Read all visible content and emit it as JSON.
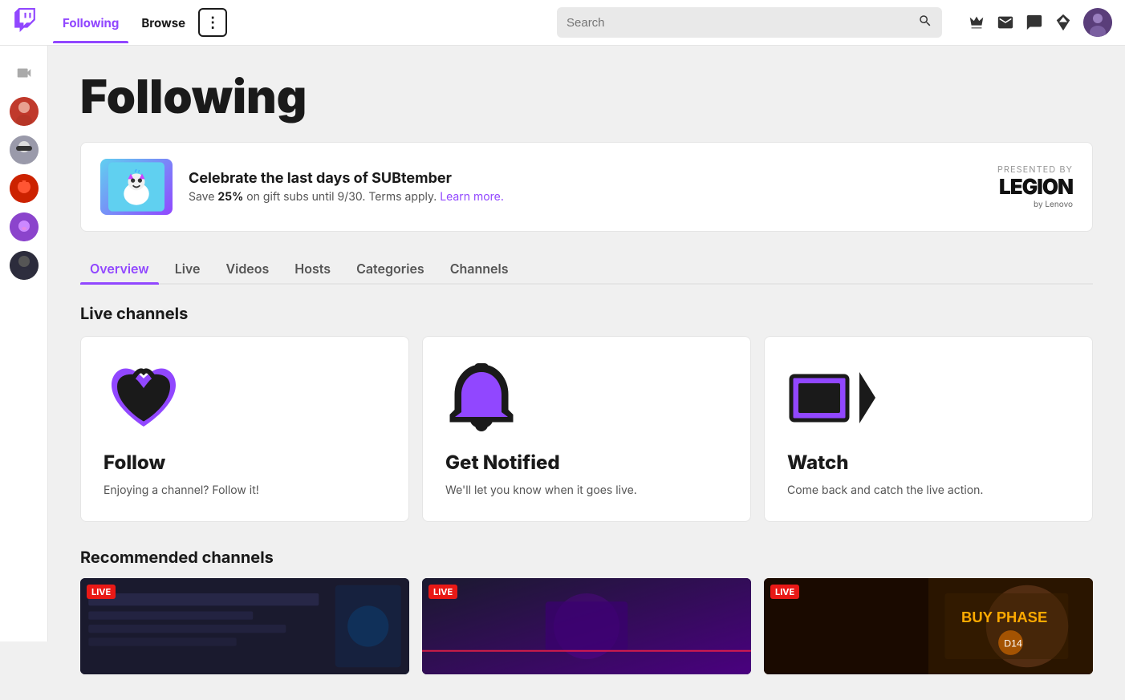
{
  "nav": {
    "logo": "twitch",
    "links": [
      {
        "id": "following",
        "label": "Following",
        "active": true
      },
      {
        "id": "browse",
        "label": "Browse",
        "active": false
      }
    ],
    "more_button_label": "⋮",
    "search_placeholder": "Search",
    "right_icons": [
      {
        "name": "crown-icon",
        "symbol": "♛"
      },
      {
        "name": "mail-icon",
        "symbol": "✉"
      },
      {
        "name": "chat-icon",
        "symbol": "⬜"
      },
      {
        "name": "diamond-icon",
        "symbol": "◆"
      }
    ]
  },
  "sidebar": {
    "top_icon": {
      "name": "camera-icon",
      "symbol": "📷"
    },
    "avatars": [
      {
        "name": "avatar-1",
        "color": "#c0392b",
        "initial": ""
      },
      {
        "name": "avatar-2",
        "color": "#7b6f8a",
        "initial": ""
      },
      {
        "name": "avatar-3",
        "color": "#e74c3c",
        "initial": ""
      },
      {
        "name": "avatar-4",
        "color": "#8b0000",
        "initial": ""
      },
      {
        "name": "avatar-5",
        "color": "#8b44ff",
        "initial": ""
      },
      {
        "name": "avatar-6",
        "color": "#2c2c2c",
        "initial": ""
      }
    ]
  },
  "page": {
    "title": "Following"
  },
  "banner": {
    "title": "Celebrate the last days of SUBtember",
    "subtitle_plain": "Save ",
    "subtitle_bold": "25%",
    "subtitle_middle": " on gift subs until 9/30. Terms apply. ",
    "subtitle_link": "Learn more.",
    "sponsor_label": "PRESENTED BY",
    "sponsor_name": "LEGION",
    "sponsor_sub": "by Lenovo"
  },
  "tabs": [
    {
      "id": "overview",
      "label": "Overview",
      "active": true
    },
    {
      "id": "live",
      "label": "Live",
      "active": false
    },
    {
      "id": "videos",
      "label": "Videos",
      "active": false
    },
    {
      "id": "hosts",
      "label": "Hosts",
      "active": false
    },
    {
      "id": "categories",
      "label": "Categories",
      "active": false
    },
    {
      "id": "channels",
      "label": "Channels",
      "active": false
    }
  ],
  "live_channels": {
    "section_title": "Live channels",
    "cards": [
      {
        "id": "follow",
        "title": "Follow",
        "description": "Enjoying a channel? Follow it!"
      },
      {
        "id": "get-notified",
        "title": "Get Notified",
        "description": "We'll let you know when it goes live."
      },
      {
        "id": "watch",
        "title": "Watch",
        "description": "Come back and catch the live action."
      }
    ]
  },
  "recommended": {
    "section_title": "Recommended channels",
    "cards": [
      {
        "id": "rec-1",
        "badge": "LIVE",
        "theme": "thumb-1"
      },
      {
        "id": "rec-2",
        "badge": "LIVE",
        "theme": "thumb-2"
      },
      {
        "id": "rec-3",
        "badge": "LIVE",
        "theme": "thumb-3"
      }
    ]
  }
}
